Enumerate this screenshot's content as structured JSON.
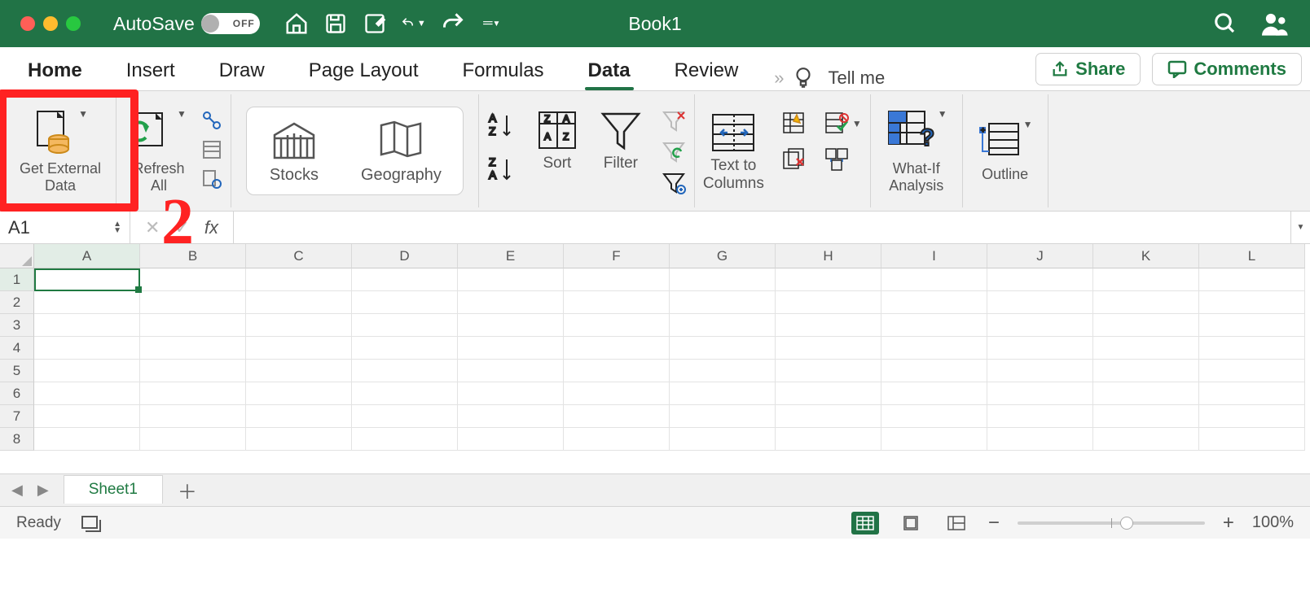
{
  "titlebar": {
    "autosave_label": "AutoSave",
    "autosave_state": "OFF",
    "document_title": "Book1"
  },
  "tabs": {
    "items": [
      "Home",
      "Insert",
      "Draw",
      "Page Layout",
      "Formulas",
      "Data",
      "Review"
    ],
    "active_index": 5,
    "tell_me": "Tell me",
    "share": "Share",
    "comments": "Comments"
  },
  "ribbon": {
    "get_external_data": "Get External\nData",
    "refresh_all": "Refresh\nAll",
    "datatypes": {
      "stocks": "Stocks",
      "geography": "Geography"
    },
    "sort": "Sort",
    "filter": "Filter",
    "text_to_columns": "Text to\nColumns",
    "what_if": "What-If\nAnalysis",
    "outline": "Outline"
  },
  "formula_bar": {
    "namebox": "A1",
    "fx": "fx",
    "formula": ""
  },
  "grid": {
    "columns": [
      "A",
      "B",
      "C",
      "D",
      "E",
      "F",
      "G",
      "H",
      "I",
      "J",
      "K",
      "L"
    ],
    "rows": [
      1,
      2,
      3,
      4,
      5,
      6,
      7,
      8
    ]
  },
  "sheet_tabs": {
    "sheets": [
      "Sheet1"
    ],
    "active": 0
  },
  "status_bar": {
    "state": "Ready",
    "zoom": "100%"
  },
  "annotation": {
    "step": "2"
  }
}
